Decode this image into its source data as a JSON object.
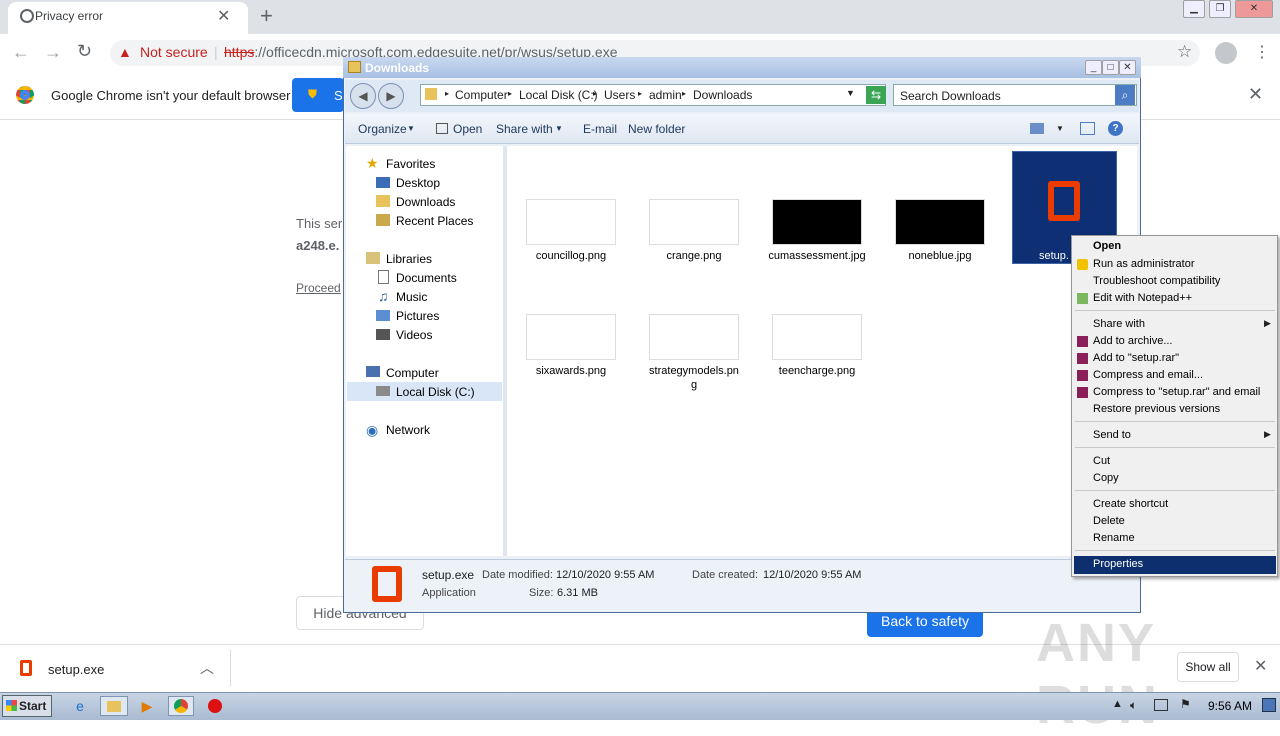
{
  "browser": {
    "tab_title": "Privacy error",
    "not_secure": "Not secure",
    "url_scheme": "https",
    "url_rest": "://officecdn.microsoft.com.edgesuite.net/pr/wsus/setup.exe",
    "infobar_text": "Google Chrome isn't your default browser",
    "infobar_button": "S",
    "error_text1": "This ser",
    "error_text2": "a248.e.",
    "proceed_link": "Proceed",
    "hide_advanced": "Hide advanced",
    "back_to_safety": "Back to safety",
    "download_name": "setup.exe",
    "show_all": "Show all",
    "watermark": "ANY RUN"
  },
  "explorer": {
    "title": "Downloads",
    "breadcrumb": [
      "Computer",
      "Local Disk (C:)",
      "Users",
      "admin",
      "Downloads"
    ],
    "search_placeholder": "Search Downloads",
    "toolbar": {
      "organize": "Organize",
      "open": "Open",
      "share_with": "Share with",
      "email": "E-mail",
      "new_folder": "New folder"
    },
    "nav": {
      "favorites": "Favorites",
      "desktop": "Desktop",
      "downloads": "Downloads",
      "recent": "Recent Places",
      "libraries": "Libraries",
      "documents": "Documents",
      "music": "Music",
      "pictures": "Pictures",
      "videos": "Videos",
      "computer": "Computer",
      "local_disk": "Local Disk (C:)",
      "network": "Network"
    },
    "files": {
      "f1": "councillog.png",
      "f2": "crange.png",
      "f3": "cumassessment.jpg",
      "f4": "noneblue.jpg",
      "f5": "setup.",
      "f6": "sixawards.png",
      "f7a": "strategymodels.pn",
      "f7b": "g",
      "f8": "teencharge.png"
    },
    "status": {
      "name": "setup.exe",
      "modified_label": "Date modified:",
      "modified": "12/10/2020 9:55 AM",
      "created_label": "Date created:",
      "created": "12/10/2020 9:55 AM",
      "type": "Application",
      "size_label": "Size:",
      "size": "6.31 MB"
    }
  },
  "context_menu": {
    "open": "Open",
    "run_admin": "Run as administrator",
    "troubleshoot": "Troubleshoot compatibility",
    "notepad": "Edit with Notepad++",
    "share_with": "Share with",
    "add_archive": "Add to archive...",
    "add_rar": "Add to \"setup.rar\"",
    "compress_email": "Compress and email...",
    "compress_rar_email": "Compress to \"setup.rar\" and email",
    "restore": "Restore previous versions",
    "send_to": "Send to",
    "cut": "Cut",
    "copy": "Copy",
    "create_shortcut": "Create shortcut",
    "delete": "Delete",
    "rename": "Rename",
    "properties": "Properties"
  },
  "taskbar": {
    "start": "Start",
    "clock": "9:56 AM"
  },
  "colors": {
    "chrome_blue": "#1a73e8",
    "office_orange": "#eb3c00",
    "selection": "#0d2f6e"
  }
}
